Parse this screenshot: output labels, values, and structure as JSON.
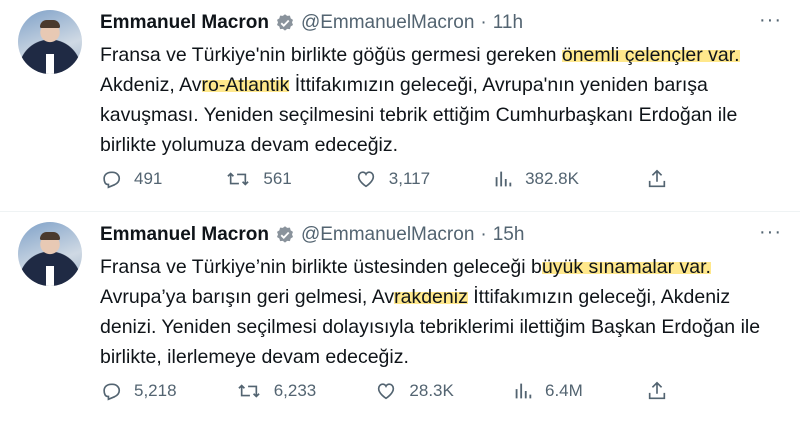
{
  "tweets": [
    {
      "author": "Emmanuel Macron",
      "handle": "@EmmanuelMacron",
      "separator": "·",
      "time": "11h",
      "more": "···",
      "text": [
        "Fransa ve Türkiye'nin birlikte göğüs germesi gereken ",
        "önemli çelençler var.",
        " Akdeniz, Av",
        "ro-Atlantik",
        " İttifakımızın geleceği, Avrupa'nın yeniden barışa kavuşması. Yeniden seçilmesini tebrik ettiğim Cumhurbaşkanı Erdoğan ile birlikte yolumuza devam edeceğiz."
      ],
      "replies": "491",
      "retweets": "561",
      "likes": "3,117",
      "views": "382.8K"
    },
    {
      "author": "Emmanuel Macron",
      "handle": "@EmmanuelMacron",
      "separator": "·",
      "time": "15h",
      "more": "···",
      "text": [
        "Fransa ve Türkiye’nin birlikte üstesinden geleceği b",
        "üyük sınamalar var.",
        " Avrupa’ya barışın geri gelmesi, Av",
        "rakdeniz",
        " İttifakımızın geleceği, Akdeniz denizi. Yeniden seçilmesi dolayısıyla tebriklerimi ilettiğim Başkan Erdoğan ile birlikte, ilerlemeye devam edeceğiz."
      ],
      "replies": "5,218",
      "retweets": "6,233",
      "likes": "28.3K",
      "views": "6.4M"
    }
  ],
  "icons": [
    "reply-icon",
    "retweet-icon",
    "like-icon",
    "views-icon",
    "share-icon",
    "verified-badge-icon",
    "more-icon"
  ],
  "colors": {
    "highlight": "#ffe066",
    "muted": "#536471",
    "text": "#0f1419"
  }
}
